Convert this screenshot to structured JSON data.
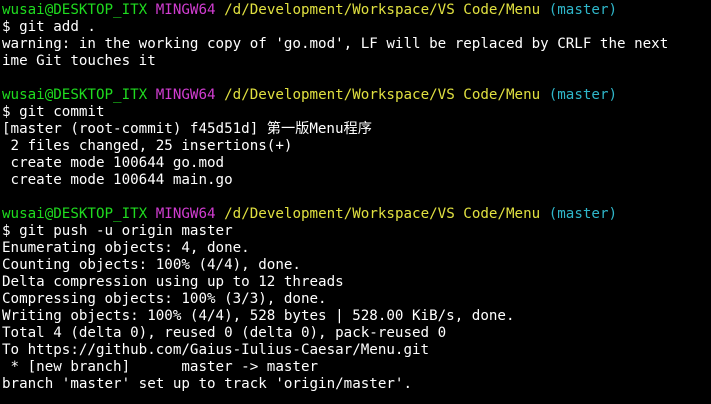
{
  "terminal": {
    "prompt": {
      "user": "wusai@DESKTOP_ITX",
      "shell": "MINGW64",
      "path": "/d/Development/Workspace/VS Code/Menu",
      "branch": "(master)"
    },
    "block1": {
      "command": "$ git add .",
      "out1": "warning: in the working copy of 'go.mod', LF will be replaced by CRLF the next",
      "out2": "ime Git touches it"
    },
    "block2": {
      "command": "$ git commit",
      "out1": "[master (root-commit) f45d51d] 第一版Menu程序",
      "out2": " 2 files changed, 25 insertions(+)",
      "out3": " create mode 100644 go.mod",
      "out4": " create mode 100644 main.go"
    },
    "block3": {
      "command": "$ git push -u origin master",
      "out1": "Enumerating objects: 4, done.",
      "out2": "Counting objects: 100% (4/4), done.",
      "out3": "Delta compression using up to 12 threads",
      "out4": "Compressing objects: 100% (3/3), done.",
      "out5": "Writing objects: 100% (4/4), 528 bytes | 528.00 KiB/s, done.",
      "out6": "Total 4 (delta 0), reused 0 (delta 0), pack-reused 0",
      "out7": "To https://github.com/Gaius-Iulius-Caesar/Menu.git",
      "out8": " * [new branch]      master -> master",
      "out9": "branch 'master' set up to track 'origin/master'."
    }
  },
  "colors": {
    "background": "#000000",
    "user": "#1fdc1f",
    "shell": "#d13dd1",
    "path": "#e0e040",
    "branch": "#2fb6c9",
    "text": "#ffffff"
  }
}
